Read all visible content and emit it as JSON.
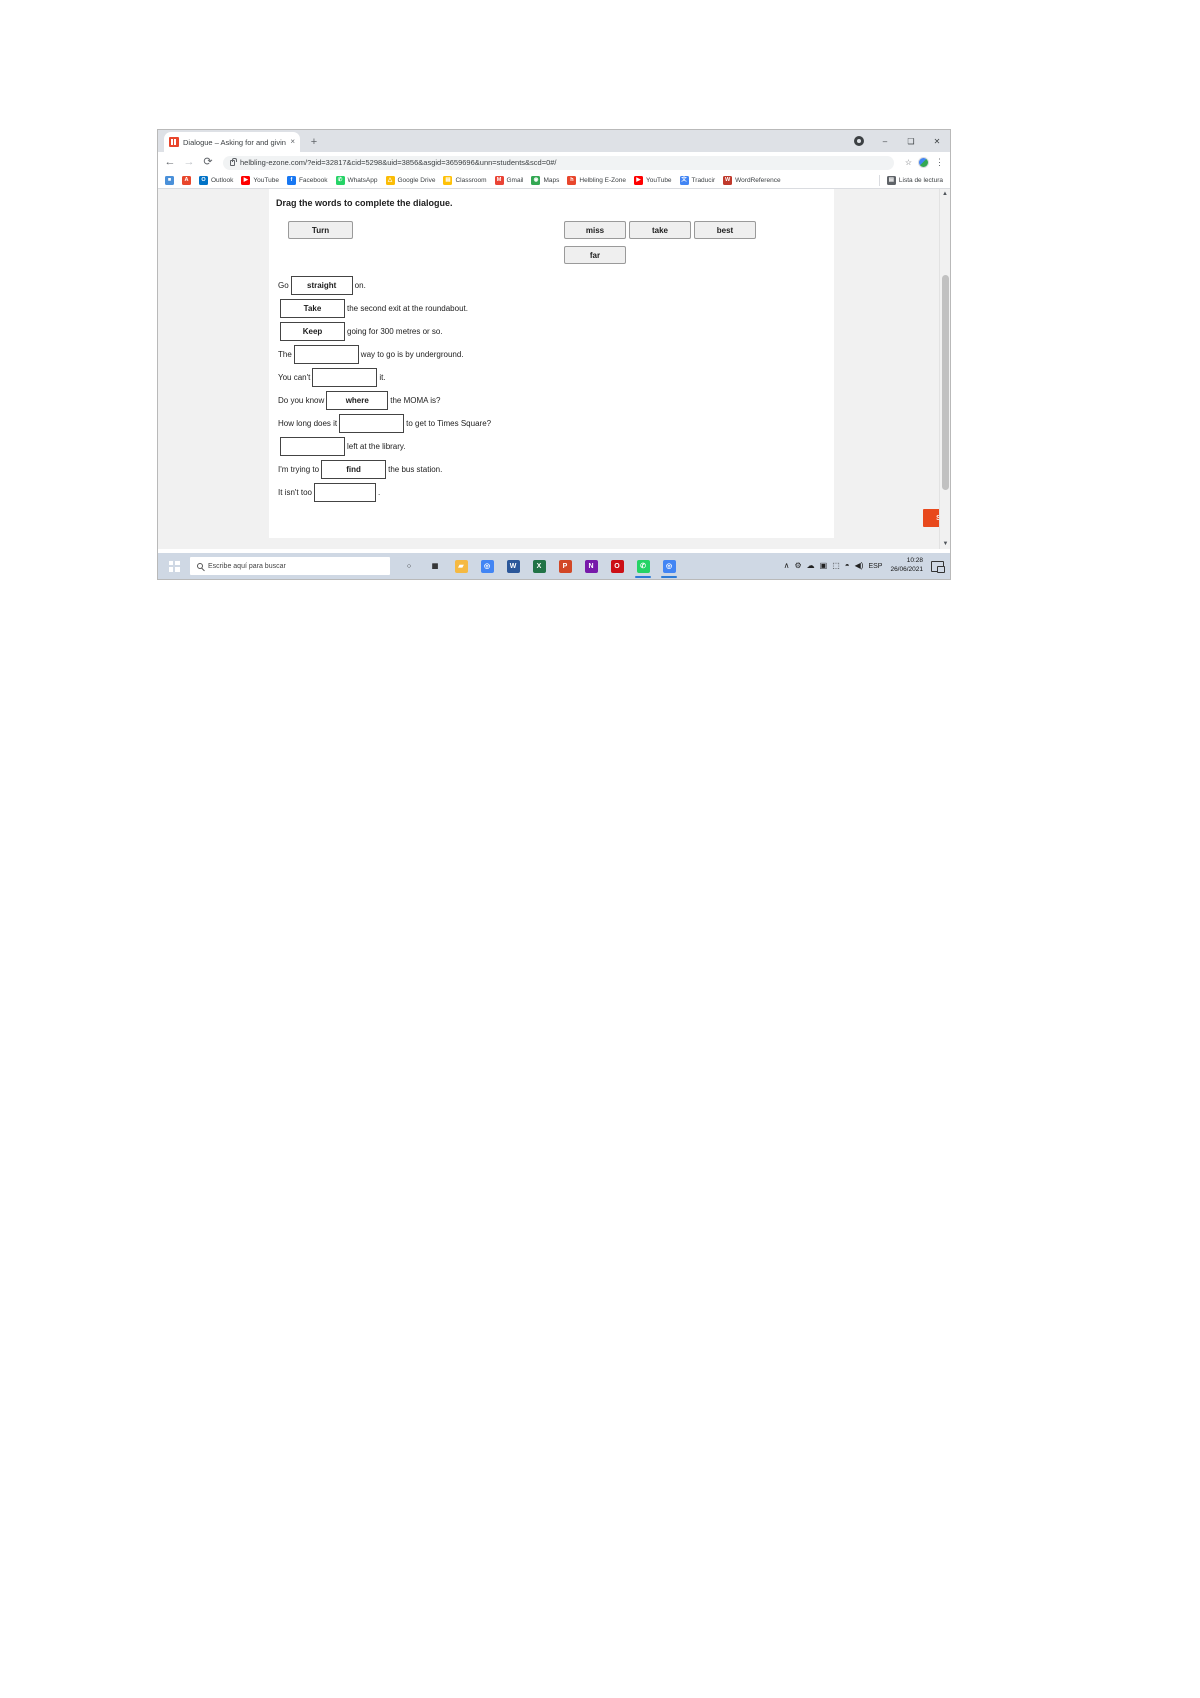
{
  "browser": {
    "tab": {
      "title": "Dialogue – Asking for and giving",
      "favicon": "helbling-icon",
      "close": "×"
    },
    "new_tab": "+",
    "window_controls": {
      "minimize": "–",
      "maximize": "❑",
      "close": "✕"
    },
    "nav": {
      "back": "←",
      "forward": "→",
      "reload": "⟳"
    },
    "omnibox": {
      "url": "helbling-ezone.com/?eid=32817&cid=5298&uid=3856&asgid=3659696&unn=students&scd=0#/",
      "lock": "lock-icon",
      "star": "☆"
    },
    "menu": "⋮",
    "bookmarks": [
      {
        "label": "",
        "letter": "■",
        "color": "#4a90d9"
      },
      {
        "label": "",
        "letter": "A",
        "color": "#e8462c"
      },
      {
        "label": "Outlook",
        "letter": "O",
        "color": "#0072c6"
      },
      {
        "label": "YouTube",
        "letter": "▶",
        "color": "#ff0000"
      },
      {
        "label": "Facebook",
        "letter": "f",
        "color": "#1877f2"
      },
      {
        "label": "WhatsApp",
        "letter": "✆",
        "color": "#25d366"
      },
      {
        "label": "Google Drive",
        "letter": "△",
        "color": "#fbbc05"
      },
      {
        "label": "Classroom",
        "letter": "▤",
        "color": "#ffc107"
      },
      {
        "label": "Gmail",
        "letter": "M",
        "color": "#ea4335"
      },
      {
        "label": "Maps",
        "letter": "◉",
        "color": "#34a853"
      },
      {
        "label": "Helbling E-Zone",
        "letter": "h",
        "color": "#e8462c"
      },
      {
        "label": "YouTube",
        "letter": "▶",
        "color": "#ff0000"
      },
      {
        "label": "Traducir",
        "letter": "文",
        "color": "#4285f4"
      },
      {
        "label": "WordReference",
        "letter": "W",
        "color": "#c0392b"
      }
    ],
    "reading_list": {
      "label": "Lista de lectura",
      "icon": "reading-list-icon"
    }
  },
  "exercise": {
    "heading": "Drag the words to complete the dialogue.",
    "answer_tile": {
      "label": "Turn"
    },
    "word_bank": [
      {
        "label": "miss"
      },
      {
        "label": "take"
      },
      {
        "label": "best"
      },
      {
        "label": "far"
      }
    ],
    "sentences": [
      {
        "before": "Go",
        "answer": "straight",
        "after": "on."
      },
      {
        "before": "",
        "answer": "Take",
        "after": "the second exit at the roundabout."
      },
      {
        "before": "",
        "answer": "Keep",
        "after": "going for 300 metres or so."
      },
      {
        "before": "The",
        "answer": "",
        "after": "way to go is by underground."
      },
      {
        "before": "You can't",
        "answer": "",
        "after": "it."
      },
      {
        "before": "Do you know",
        "answer": "where",
        "after": "the MOMA is?"
      },
      {
        "before": "How long does it",
        "answer": "",
        "after": "to get to Times Square?"
      },
      {
        "before": "",
        "answer": "",
        "after": "left at the library."
      },
      {
        "before": "I'm trying to",
        "answer": "find",
        "after": "the bus station."
      },
      {
        "before": "It isn't too",
        "answer": "",
        "after": "."
      }
    ],
    "submit": {
      "label": "SUBMIT",
      "color": "#e8491d"
    }
  },
  "taskbar": {
    "start": "windows-logo",
    "search_placeholder": "Escribe aquí para buscar",
    "apps": [
      {
        "name": "cortana-icon",
        "letter": "○",
        "color": "#cfd8e4",
        "active": false
      },
      {
        "name": "task-view-icon",
        "letter": "▦",
        "color": "#cfd8e4",
        "active": false
      },
      {
        "name": "file-explorer-icon",
        "letter": "▰",
        "color": "#f5b942",
        "active": false
      },
      {
        "name": "chrome-icon",
        "letter": "◎",
        "color": "#4285f4",
        "active": false
      },
      {
        "name": "word-icon",
        "letter": "W",
        "color": "#2b579a",
        "active": false
      },
      {
        "name": "excel-icon",
        "letter": "X",
        "color": "#217346",
        "active": false
      },
      {
        "name": "powerpoint-icon",
        "letter": "P",
        "color": "#d24726",
        "active": false
      },
      {
        "name": "onenote-icon",
        "letter": "N",
        "color": "#7719aa",
        "active": false
      },
      {
        "name": "opera-icon",
        "letter": "O",
        "color": "#cc0f16",
        "active": false
      },
      {
        "name": "whatsapp-icon",
        "letter": "✆",
        "color": "#25d366",
        "active": true
      },
      {
        "name": "chrome-window-icon",
        "letter": "◎",
        "color": "#4285f4",
        "active": true
      }
    ],
    "tray": {
      "chevron": "∧",
      "icons": [
        "⚙",
        "☁",
        "▣",
        "⬚",
        "◳",
        "◆"
      ],
      "volume": "◀)",
      "language": "ESP",
      "time": "10:28",
      "date": "26/06/2021",
      "action_center": "notification-icon"
    }
  }
}
